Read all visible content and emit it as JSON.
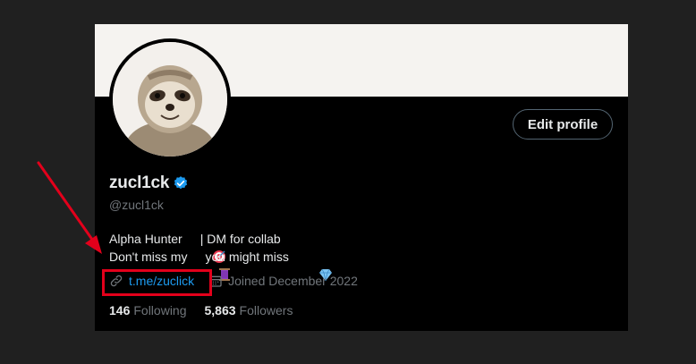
{
  "profile": {
    "display_name": "zucl1ck",
    "handle": "@zucl1ck",
    "edit_label": "Edit profile",
    "bio": {
      "line1_a": "Alpha Hunter",
      "line1_b": "| DM for collab",
      "line2_a": "Don't miss my",
      "line2_b": "you might miss",
      "emojis": [
        "direct-hit-icon",
        "thread-spool-icon",
        "gem-icon"
      ]
    },
    "link": "t.me/zuclick",
    "joined": "Joined December 2022",
    "following_count": "146",
    "following_label": "Following",
    "followers_count": "5,863",
    "followers_label": "Followers"
  },
  "colors": {
    "background": "#202020",
    "card": "#000000",
    "link": "#1d9bf0",
    "text": "#e7e9ea",
    "muted": "#71767b",
    "verified": "#1d9bf0",
    "annotation": "#e3001b"
  }
}
